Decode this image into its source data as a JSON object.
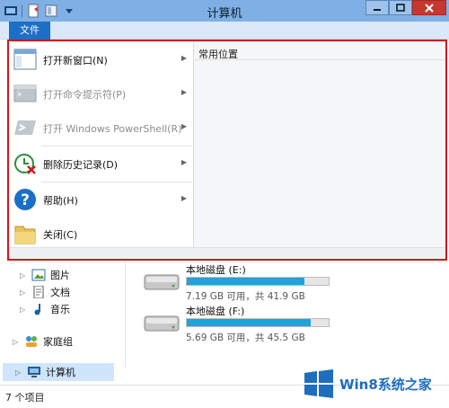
{
  "window": {
    "title": "计算机"
  },
  "ribbon": {
    "file_tab": "文件"
  },
  "file_menu": {
    "items": [
      {
        "label": "打开新窗口(N)",
        "icon": "new-window-icon",
        "disabled": false
      },
      {
        "label": "打开命令提示符(P)",
        "icon": "command-prompt-icon",
        "disabled": true
      },
      {
        "label": "打开 Windows PowerShell(R)",
        "icon": "powershell-icon",
        "disabled": true
      },
      {
        "label": "删除历史记录(D)",
        "icon": "delete-history-icon",
        "disabled": false
      },
      {
        "label": "帮助(H)",
        "icon": "help-icon",
        "disabled": false
      },
      {
        "label": "关闭(C)",
        "icon": "close-folder-icon",
        "disabled": false
      }
    ],
    "frequent_places_title": "常用位置"
  },
  "nav": {
    "items": [
      {
        "label": "图片",
        "icon": "pictures-icon"
      },
      {
        "label": "文档",
        "icon": "documents-icon"
      },
      {
        "label": "音乐",
        "icon": "music-icon"
      },
      {
        "label": "家庭组",
        "icon": "homegroup-icon"
      },
      {
        "label": "计算机",
        "icon": "computer-icon"
      }
    ]
  },
  "drives": [
    {
      "name": "本地磁盘 (E:)",
      "info": "7.19 GB 可用，共 41.9 GB",
      "used_fraction": 0.828
    },
    {
      "name": "本地磁盘 (F:)",
      "info": "5.69 GB 可用，共 45.5 GB",
      "used_fraction": 0.875
    }
  ],
  "status": {
    "item_count": "7 个项目"
  },
  "watermark": {
    "text": "Win8系统之家"
  },
  "colors": {
    "accent": "#1a6fc7",
    "highlight_border": "#d0181f",
    "drive_bar": "#26a0da",
    "titlebar": "#7fb0e5"
  }
}
